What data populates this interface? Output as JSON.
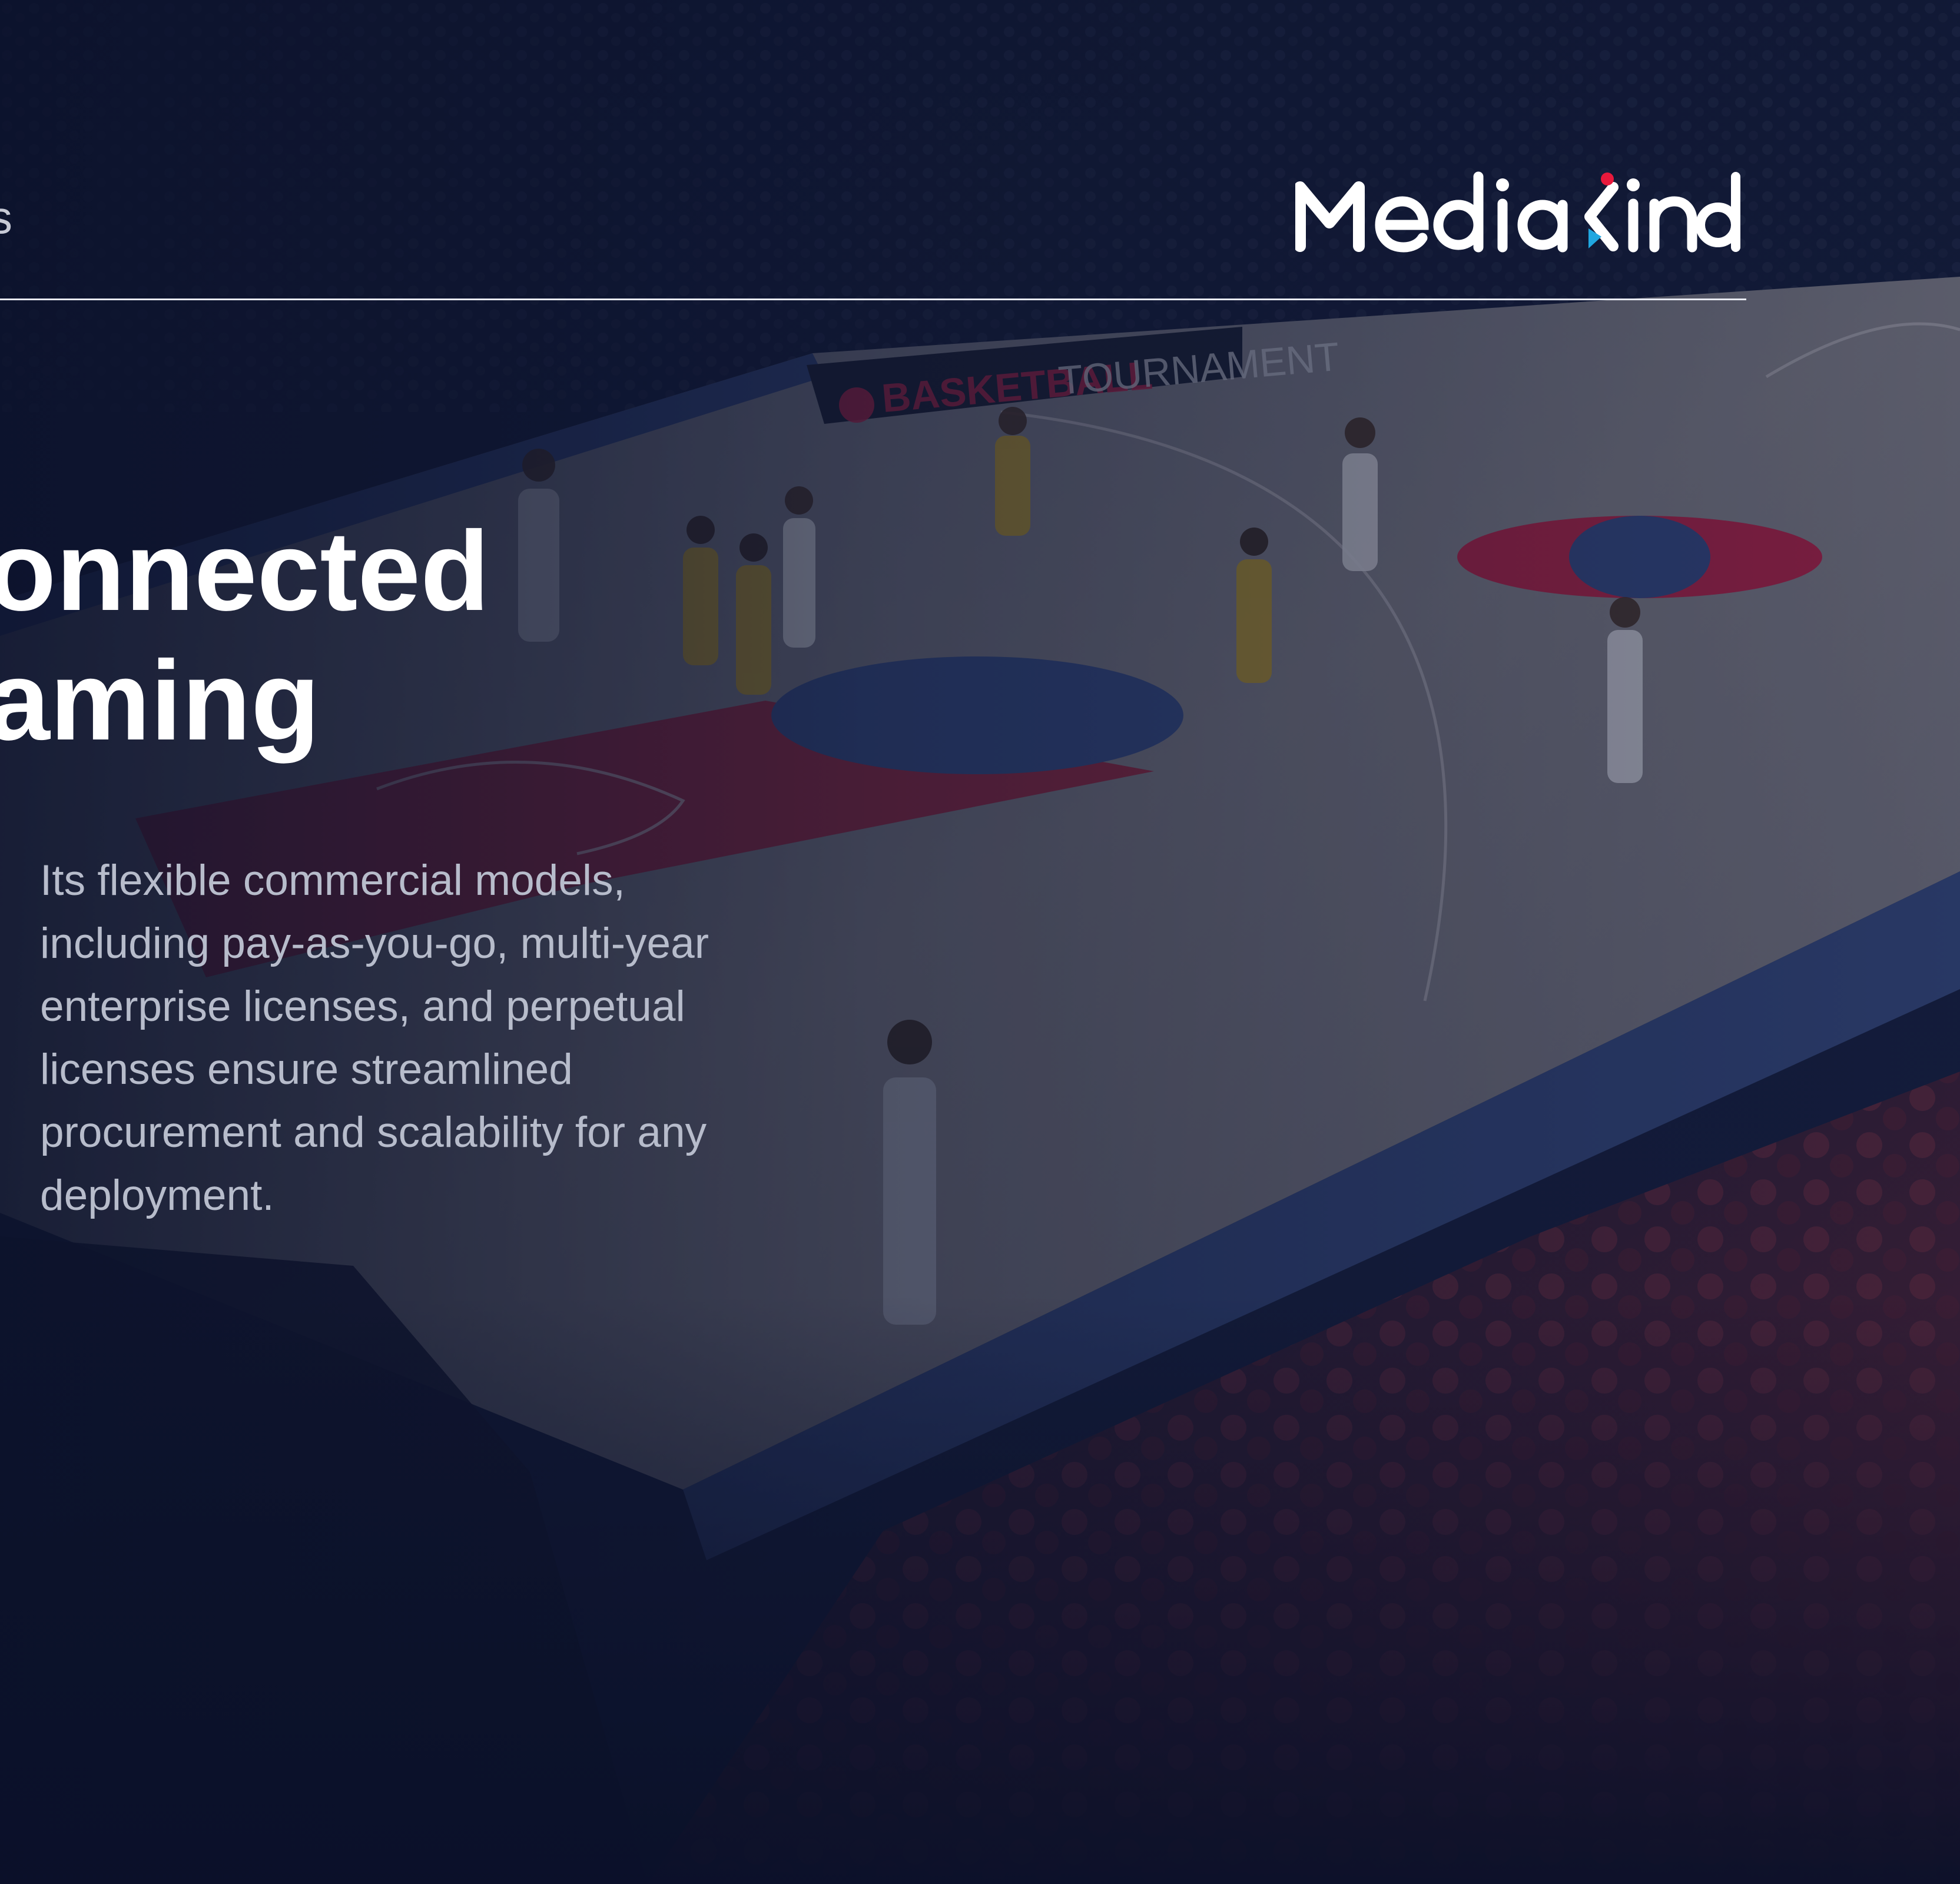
{
  "header": {
    "section_label": "s",
    "logo": {
      "text": "MediaKind",
      "accent_colors": [
        "#e8193c",
        "#20a7e0"
      ]
    }
  },
  "hero": {
    "title_lines": [
      "onnected",
      "aming"
    ],
    "body": "Its flexible commercial models,\nincluding pay-as-you-go, multi-year\nenterprise licenses, and perpetual\nlicenses ensure streamlined\nprocurement and scalability for any\ndeployment."
  },
  "background": {
    "subject": "basketball-arena",
    "banner_text": "BASKETBALLTOURNAMENT",
    "colors": {
      "overlay_top": "#0e1733",
      "overlay_bottom": "#0a0f26",
      "court": "#8f8d8f",
      "paint_red": "#b2243f",
      "paint_blue": "#3b5590",
      "crowd_red": "#6b2a3a"
    }
  }
}
